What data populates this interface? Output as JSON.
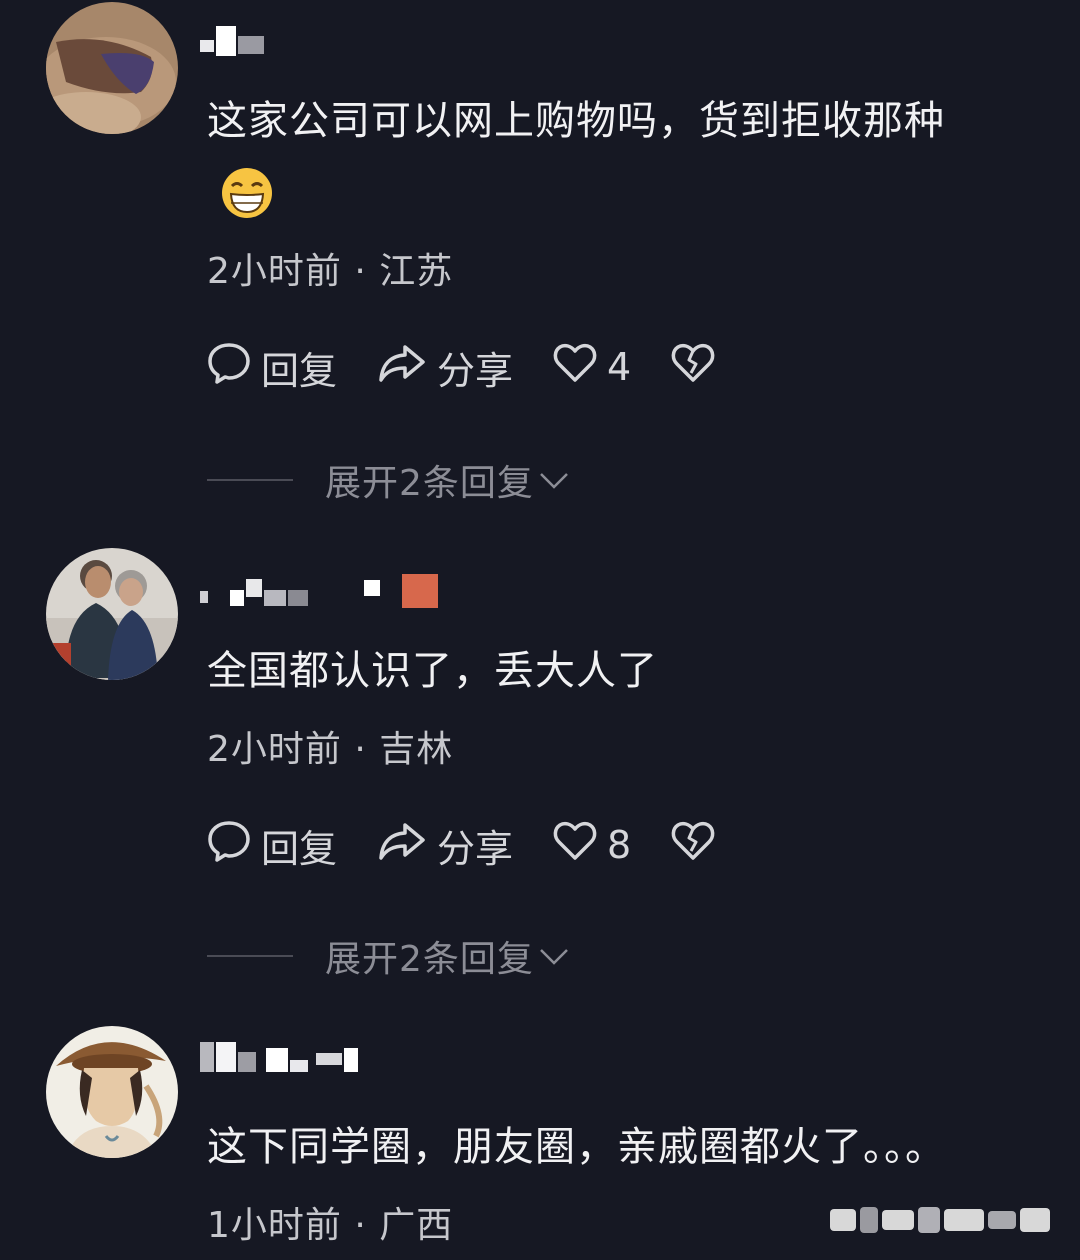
{
  "comments": [
    {
      "text": "这家公司可以网上购物吗，货到拒收那种",
      "emoji": "grinning-face-emoji",
      "meta": "2小时前 · 江苏",
      "reply_label": "回复",
      "share_label": "分享",
      "likes": "4",
      "expand_label": "展开2条回复"
    },
    {
      "text": "全国都认识了，丢大人了",
      "meta": "2小时前 · 吉林",
      "reply_label": "回复",
      "share_label": "分享",
      "likes": "8",
      "expand_label": "展开2条回复"
    },
    {
      "text": "这下同学圈，朋友圈，亲戚圈都火了。。。",
      "meta": "1小时前 · 广西"
    }
  ],
  "colors": {
    "background": "#161823",
    "text": "#f1f1f3",
    "meta": "#c6c7cc",
    "expand": "#8c8d96"
  },
  "icons": [
    "comment-bubble-icon",
    "share-arrow-icon",
    "heart-icon",
    "broken-heart-icon",
    "chevron-down-icon"
  ]
}
